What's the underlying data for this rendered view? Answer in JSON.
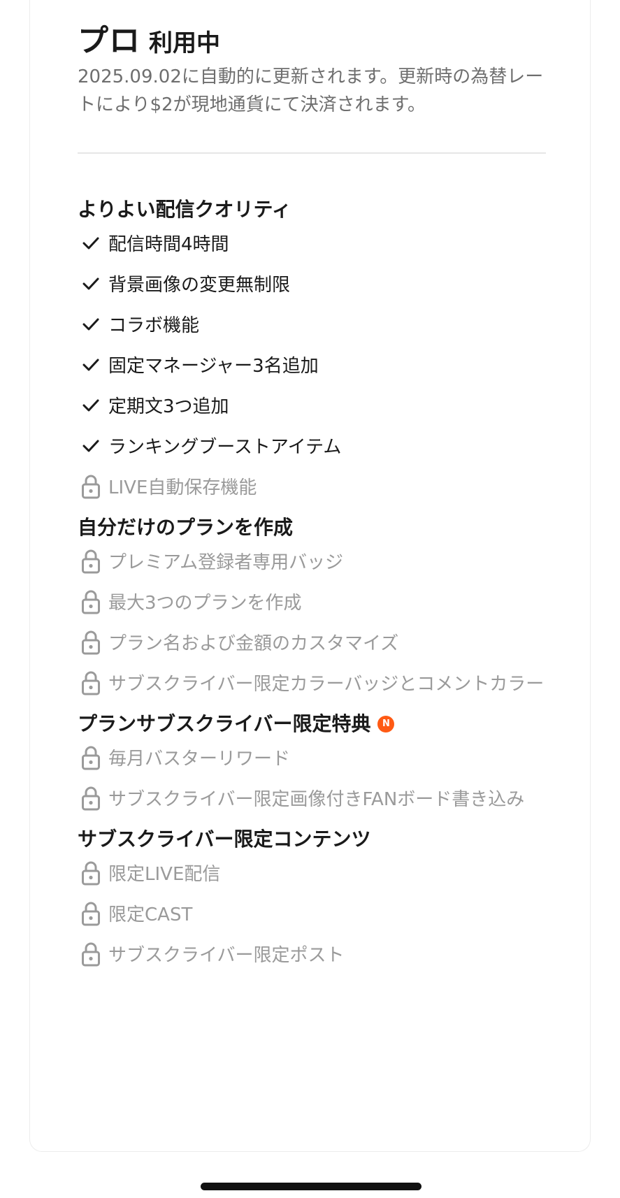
{
  "plan": {
    "name": "プロ",
    "status": "利用中",
    "renewal_notice": "2025.09.02に自動的に更新されます。更新時の為替レートにより$2が現地通貨にて決済されます。"
  },
  "sections": [
    {
      "title": "よりよい配信クオリティ",
      "items": [
        {
          "label": "配信時間4時間",
          "icon": "check-icon"
        },
        {
          "label": "背景画像の変更無制限",
          "icon": "check-icon"
        },
        {
          "label": "コラボ機能",
          "icon": "check-icon"
        },
        {
          "label": "固定マネージャー3名追加",
          "icon": "check-icon"
        },
        {
          "label": "定期文3つ追加",
          "icon": "check-icon"
        },
        {
          "label": "ランキングブーストアイテム",
          "icon": "check-icon"
        },
        {
          "label": "LIVE自動保存機能",
          "icon": "lock-icon"
        }
      ]
    },
    {
      "title": "自分だけのプランを作成",
      "items": [
        {
          "label": "プレミアム登録者専用バッジ",
          "icon": "lock-icon"
        },
        {
          "label": "最大3つのプランを作成",
          "icon": "lock-icon"
        },
        {
          "label": "プラン名および金額のカスタマイズ",
          "icon": "lock-icon"
        },
        {
          "label": "サブスクライバー限定カラーバッジとコメントカラー",
          "icon": "lock-icon"
        }
      ]
    },
    {
      "title": "プランサブスクライバー限定特典",
      "badge": "N",
      "items": [
        {
          "label": "毎月バスターリワード",
          "icon": "lock-icon"
        },
        {
          "label": "サブスクライバー限定画像付きFANボード書き込み",
          "icon": "lock-icon"
        }
      ]
    },
    {
      "title": "サブスクライバー限定コンテンツ",
      "items": [
        {
          "label": "限定LIVE配信",
          "icon": "lock-icon"
        },
        {
          "label": "限定CAST",
          "icon": "lock-icon"
        },
        {
          "label": "サブスクライバー限定ポスト",
          "icon": "lock-icon"
        }
      ]
    }
  ],
  "colors": {
    "accent_badge": "#ff5a14",
    "unlocked_text": "#1a1a1a",
    "locked_text": "#9a9a9a"
  }
}
